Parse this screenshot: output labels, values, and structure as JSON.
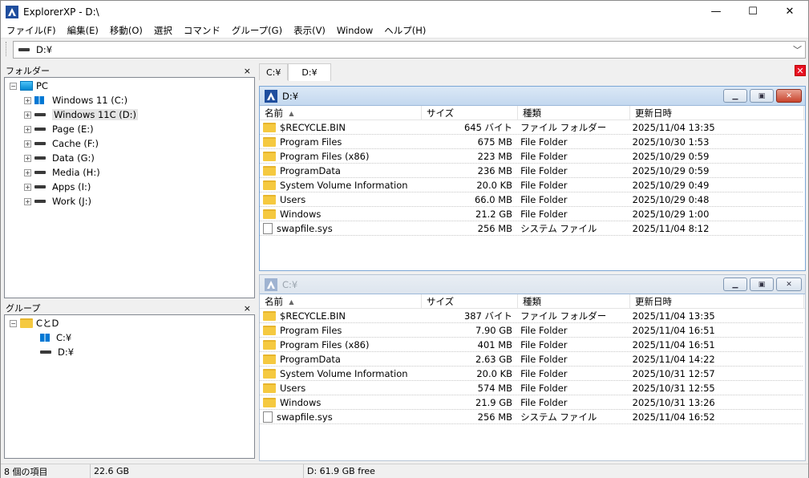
{
  "window": {
    "title": "ExplorerXP - D:\\",
    "minimize": "—",
    "maximize": "☐",
    "close": "✕"
  },
  "menu": [
    "ファイル(F)",
    "編集(E)",
    "移動(O)",
    "選択",
    "コマンド",
    "グループ(G)",
    "表示(V)",
    "Window",
    "ヘルプ(H)"
  ],
  "address": {
    "value": "D:¥",
    "dropdown": "﹀"
  },
  "folders_panel": {
    "title": "フォルダー",
    "close": "×",
    "root": "PC",
    "drives": [
      "Windows 11 (C:)",
      "Windows 11C (D:)",
      "Page (E:)",
      "Cache (F:)",
      "Data (G:)",
      "Media (H:)",
      "Apps (I:)",
      "Work (J:)"
    ],
    "selected_index": 1
  },
  "groups_panel": {
    "title": "グループ",
    "close": "×",
    "group_name": "CとD",
    "members": [
      "C:¥",
      "D:¥"
    ]
  },
  "tabs": [
    "C:¥",
    "D:¥"
  ],
  "active_tab": 1,
  "close_tab_button": "✕",
  "columns": [
    "名前",
    "サイズ",
    "種類",
    "更新日時"
  ],
  "sort_indicator": "▲",
  "pane_d": {
    "title": "D:¥",
    "rows": [
      {
        "name": "$RECYCLE.BIN",
        "size": "645 バイト",
        "type": "ファイル フォルダー",
        "date": "2025/11/04 13:35",
        "icon": "folder"
      },
      {
        "name": "Program Files",
        "size": "675 MB",
        "type": "File Folder",
        "date": "2025/10/30 1:53",
        "icon": "folder"
      },
      {
        "name": "Program Files (x86)",
        "size": "223 MB",
        "type": "File Folder",
        "date": "2025/10/29 0:59",
        "icon": "folder"
      },
      {
        "name": "ProgramData",
        "size": "236 MB",
        "type": "File Folder",
        "date": "2025/10/29 0:59",
        "icon": "folder"
      },
      {
        "name": "System Volume Information",
        "size": "20.0 KB",
        "type": "File Folder",
        "date": "2025/10/29 0:49",
        "icon": "folder"
      },
      {
        "name": "Users",
        "size": "66.0 MB",
        "type": "File Folder",
        "date": "2025/10/29 0:48",
        "icon": "folder"
      },
      {
        "name": "Windows",
        "size": "21.2 GB",
        "type": "File Folder",
        "date": "2025/10/29 1:00",
        "icon": "folder"
      },
      {
        "name": "swapfile.sys",
        "size": "256 MB",
        "type": "システム ファイル",
        "date": "2025/11/04 8:12",
        "icon": "file"
      }
    ]
  },
  "pane_c": {
    "title": "C:¥",
    "rows": [
      {
        "name": "$RECYCLE.BIN",
        "size": "387 バイト",
        "type": "ファイル フォルダー",
        "date": "2025/11/04 13:35",
        "icon": "folder"
      },
      {
        "name": "Program Files",
        "size": "7.90 GB",
        "type": "File Folder",
        "date": "2025/11/04 16:51",
        "icon": "folder"
      },
      {
        "name": "Program Files (x86)",
        "size": "401 MB",
        "type": "File Folder",
        "date": "2025/11/04 16:51",
        "icon": "folder"
      },
      {
        "name": "ProgramData",
        "size": "2.63 GB",
        "type": "File Folder",
        "date": "2025/11/04 14:22",
        "icon": "folder"
      },
      {
        "name": "System Volume Information",
        "size": "20.0 KB",
        "type": "File Folder",
        "date": "2025/10/31 12:57",
        "icon": "folder"
      },
      {
        "name": "Users",
        "size": "574 MB",
        "type": "File Folder",
        "date": "2025/10/31 12:55",
        "icon": "folder"
      },
      {
        "name": "Windows",
        "size": "21.9 GB",
        "type": "File Folder",
        "date": "2025/10/31 13:26",
        "icon": "folder"
      },
      {
        "name": "swapfile.sys",
        "size": "256 MB",
        "type": "システム ファイル",
        "date": "2025/11/04 16:52",
        "icon": "file"
      }
    ]
  },
  "status": {
    "count": "8 個の項目",
    "size": "22.6 GB",
    "free": "D: 61.9 GB free"
  }
}
